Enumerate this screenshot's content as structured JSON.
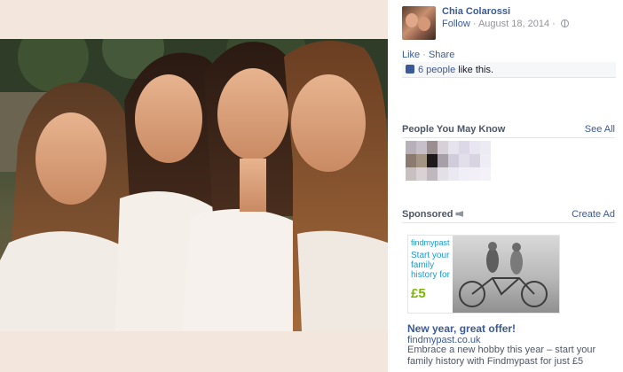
{
  "post": {
    "author": "Chia Colarossi",
    "follow_label": "Follow",
    "meta_sep": " · ",
    "date": "August 18, 2014",
    "privacy_icon": "globe-icon",
    "like_label": "Like",
    "action_sep": " · ",
    "share_label": "Share",
    "likes_count_text": "6 people",
    "likes_suffix": " like this.",
    "like_icon": "thumbs-up-icon"
  },
  "people_you_may_know": {
    "title": "People You May Know",
    "see_all_label": "See All"
  },
  "sponsored": {
    "title": "Sponsored",
    "title_icon": "megaphone-icon",
    "create_ad_label": "Create Ad",
    "ad": {
      "brand": "findmypast",
      "image_tagline": "Start your family history for",
      "image_price": "£5",
      "headline": "New year, great offer!",
      "url": "findmypast.co.uk",
      "body": "Embrace a new hobby this year – start your family history with Findmypast for just £5"
    }
  },
  "colors": {
    "link": "#3b5998",
    "muted": "#90949c",
    "brand_blue": "#1a9ad6",
    "brand_green": "#7ab800"
  }
}
